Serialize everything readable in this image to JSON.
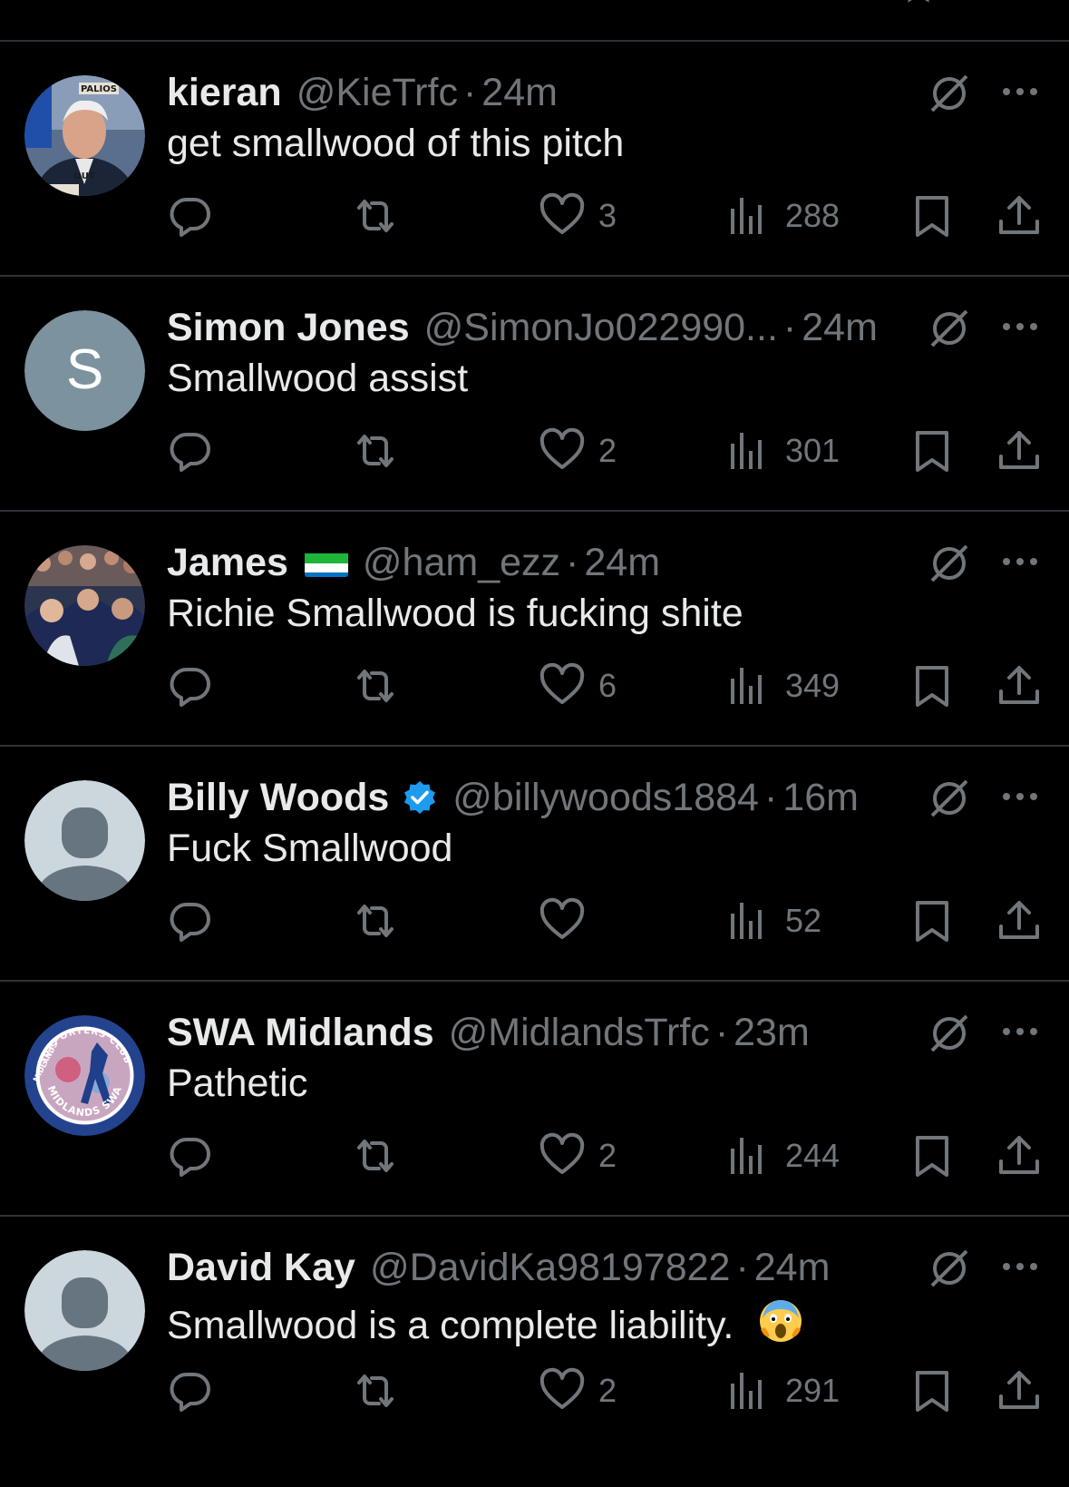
{
  "colors": {
    "background": "#000000",
    "primary_text": "#e7e9ea",
    "secondary_text": "#71767b",
    "divider": "#2f3336",
    "verified_blue": "#1d9bf0"
  },
  "icons": {
    "reply": "reply-icon",
    "retweet": "retweet-icon",
    "like": "heart-icon",
    "views": "views-icon",
    "bookmark": "bookmark-icon",
    "share": "share-icon",
    "grok": "grok-icon",
    "more": "more-icon"
  },
  "tweets": [
    {
      "name": "kieran",
      "handle": "@KieTrfc",
      "dot": "·",
      "time": "24m",
      "text": "get smallwood of this pitch",
      "likes": "3",
      "views": "288",
      "avatar": {
        "type": "photo",
        "caption_top": "PALIOS",
        "caption_bottom": "OUT"
      }
    },
    {
      "name": "Simon Jones",
      "handle": "@SimonJo022990...",
      "dot": "·",
      "time": "24m",
      "text": "Smallwood assist",
      "likes": "2",
      "views": "301",
      "avatar": {
        "type": "letter",
        "letter": "S",
        "color": "#7c929e"
      }
    },
    {
      "name": "James",
      "handle": "@ham_ezz",
      "dot": "·",
      "time": "24m",
      "text": "Richie Smallwood is fucking shite",
      "likes": "6",
      "views": "349",
      "avatar": {
        "type": "photo"
      },
      "flag": "sierra-leone-flag"
    },
    {
      "name": "Billy Woods",
      "handle": "@billywoods1884",
      "dot": "·",
      "time": "16m",
      "text": "Fuck Smallwood",
      "likes": "",
      "views": "52",
      "avatar": {
        "type": "default"
      },
      "verified": true
    },
    {
      "name": "SWA Midlands",
      "handle": "@MidlandsTrfc",
      "dot": "·",
      "time": "23m",
      "text": "Pathetic",
      "likes": "2",
      "views": "244",
      "avatar": {
        "type": "badge",
        "ring_text_top": "SUPPORTERS CLUB",
        "ring_text_left": "MIDLANDS",
        "ring_text_bottom": "MIDLANDS SWA"
      }
    },
    {
      "name": "David Kay",
      "handle": "@DavidKa98197822",
      "dot": "·",
      "time": "24m",
      "text": "Smallwood is a complete liability.",
      "likes": "2",
      "views": "291",
      "avatar": {
        "type": "default"
      },
      "emoji": "screaming-face-emoji"
    }
  ]
}
